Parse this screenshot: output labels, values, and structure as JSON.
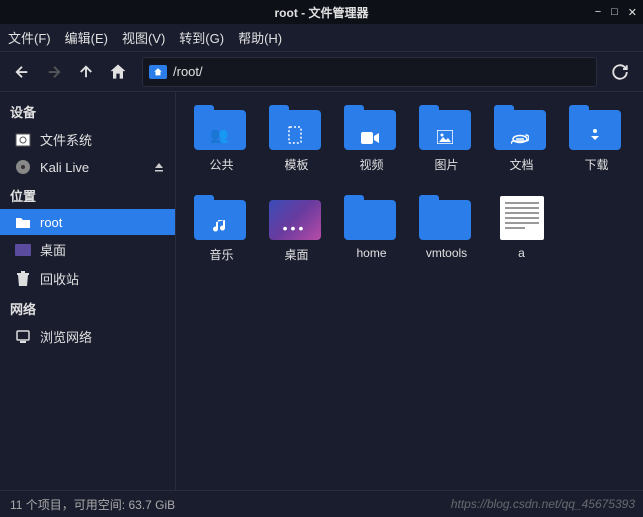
{
  "window": {
    "title": "root - 文件管理器"
  },
  "menu": {
    "file": "文件(F)",
    "edit": "编辑(E)",
    "view": "视图(V)",
    "go": "转到(G)",
    "help": "帮助(H)"
  },
  "path": {
    "value": "/root/"
  },
  "sidebar": {
    "devices_header": "设备",
    "places_header": "位置",
    "network_header": "网络",
    "filesystem": "文件系统",
    "kalilive": "Kali Live",
    "root": "root",
    "desktop": "桌面",
    "trash": "回收站",
    "browse_network": "浏览网络"
  },
  "items": {
    "public": "公共",
    "templates": "模板",
    "videos": "视频",
    "pictures": "图片",
    "documents": "文档",
    "downloads": "下载",
    "music": "音乐",
    "desktop": "桌面",
    "home": "home",
    "vmtools": "vmtools",
    "a": "a"
  },
  "status": {
    "text": "11 个项目，可用空间: 63.7 GiB"
  },
  "watermark": "https://blog.csdn.net/qq_45675393"
}
